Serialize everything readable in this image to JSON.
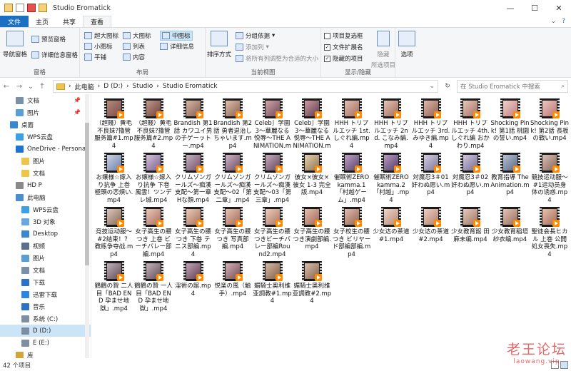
{
  "window": {
    "title": "Studio Eromatick",
    "min": "—",
    "max": "☐",
    "close": "✕"
  },
  "tabs": [
    "文件",
    "主页",
    "共享",
    "查看"
  ],
  "ribbon": {
    "panes": {
      "nav": "导航窗格",
      "preview": "预览窗格",
      "details": "详细信息窗格",
      "group": "窗格"
    },
    "layout": {
      "xl": "超大图标",
      "large": "大图标",
      "medium": "中图标",
      "small": "小图标",
      "list": "列表",
      "details": "详细信息",
      "tiles": "平铺",
      "content": "内容",
      "group": "布局"
    },
    "currentview": {
      "sort": "排序方式",
      "groupby": "分组依据",
      "addcol": "添加列",
      "fit": "将所有列调整为合适的大小",
      "group": "当前视图"
    },
    "showhide": {
      "cb_items": "项目复选框",
      "ext": "文件扩展名",
      "hidden": "隐藏的项目",
      "hide_sel1": "隐藏",
      "hide_sel2": "所选项目",
      "group": "显示/隐藏"
    },
    "options": "选项"
  },
  "address": {
    "crumbs": [
      "此电脑",
      "D (D:)",
      "Studio",
      "Studio Eromatick"
    ],
    "search_placeholder": "在 Studio Eromatick 中搜索"
  },
  "nav": [
    {
      "label": "文档",
      "icon": "document-icon",
      "color": "#7a8fa8",
      "indent": 22,
      "pin": true
    },
    {
      "label": "图片",
      "icon": "pictures-icon",
      "color": "#5a9fd4",
      "indent": 22,
      "pin": true
    },
    {
      "label": "桌面",
      "icon": "desktop-icon",
      "color": "#3a87d0",
      "indent": 14,
      "pin": false
    },
    {
      "label": "WPS云盘",
      "icon": "cloud-icon",
      "color": "#3aa0e8",
      "indent": 22,
      "pin": false
    },
    {
      "label": "OneDrive - Personal",
      "icon": "onedrive-icon",
      "color": "#1b74d0",
      "indent": 22,
      "pin": false
    },
    {
      "label": "图片",
      "icon": "folder-icon",
      "color": "#f0c34a",
      "indent": 30,
      "pin": false
    },
    {
      "label": "文档",
      "icon": "folder-icon",
      "color": "#f0c34a",
      "indent": 30,
      "pin": false
    },
    {
      "label": "HD P",
      "icon": "user-icon",
      "color": "#8a8a8a",
      "indent": 22,
      "pin": false
    },
    {
      "label": "此电脑",
      "icon": "pc-icon",
      "color": "#4c8dd0",
      "indent": 22,
      "pin": false
    },
    {
      "label": "WPS云盘",
      "icon": "cloud-icon",
      "color": "#3aa0e8",
      "indent": 30,
      "pin": false
    },
    {
      "label": "3D 对象",
      "icon": "cube-icon",
      "color": "#6aa6e0",
      "indent": 30,
      "pin": false
    },
    {
      "label": "Desktop",
      "icon": "desktop-icon",
      "color": "#3a87d0",
      "indent": 30,
      "pin": false
    },
    {
      "label": "视频",
      "icon": "video-icon",
      "color": "#5b6f8c",
      "indent": 30,
      "pin": false
    },
    {
      "label": "图片",
      "icon": "pictures-icon",
      "color": "#5a9fd4",
      "indent": 30,
      "pin": false
    },
    {
      "label": "文档",
      "icon": "document-icon",
      "color": "#7a8fa8",
      "indent": 30,
      "pin": false
    },
    {
      "label": "下载",
      "icon": "download-icon",
      "color": "#2c73c8",
      "indent": 30,
      "pin": false
    },
    {
      "label": "迅雷下载",
      "icon": "thunder-icon",
      "color": "#2b86e0",
      "indent": 30,
      "pin": false
    },
    {
      "label": "音乐",
      "icon": "music-icon",
      "color": "#2c73c8",
      "indent": 30,
      "pin": false
    },
    {
      "label": "系统 (C:)",
      "icon": "drive-icon",
      "color": "#7f8fa3",
      "indent": 30,
      "pin": false
    },
    {
      "label": "D (D:)",
      "icon": "drive-icon",
      "color": "#7f8fa3",
      "indent": 30,
      "pin": false,
      "selected": true
    },
    {
      "label": "E (E:)",
      "icon": "drive-icon",
      "color": "#7f8fa3",
      "indent": 30,
      "pin": false
    },
    {
      "label": "库",
      "icon": "library-icon",
      "color": "#d4a33a",
      "indent": 22,
      "pin": false
    }
  ],
  "files": [
    {
      "name": "（超賤）黄毛不良妹?擼管服务篇#1.mp4",
      "c1": "#b58a7a",
      "c2": "#7a4c4a"
    },
    {
      "name": "（超賤）黄毛不良妹?擼管服务篇#2.mp4",
      "c1": "#c49a8a",
      "c2": "#6d3e3c"
    },
    {
      "name": "Brandish 第1話 カワユイ男の子ゲーットー.mp4",
      "c1": "#d8b8a4",
      "c2": "#835c53"
    },
    {
      "name": "Brandish 第2話 勇者退治しちゃいます.mp4",
      "c1": "#e0c0ac",
      "c2": "#8a6252"
    },
    {
      "name": "Celeb］学園3～華麗なる悦辱～THE ANIMATION.mp4",
      "c1": "#d3a5a8",
      "c2": "#6e4a5a"
    },
    {
      "name": "Celeb］学園3～華麗なる悦辱～THE ANIMATION.mp4",
      "c1": "#cf9aa2",
      "c2": "#5a3c4e"
    },
    {
      "name": "HHH トリプルエッチ 1st. しぐれ編.mp4",
      "c1": "#e3bfb1",
      "c2": "#a06c60"
    },
    {
      "name": "HHH トリプルエッチ 2nd. こなみ編.mp4",
      "c1": "#e6c6b6",
      "c2": "#9e6a5d"
    },
    {
      "name": "HHH トリプルエッチ 3rd. みゆき編.mp4",
      "c1": "#dfb8a9",
      "c2": "#8f5f53"
    },
    {
      "name": "HHH トリプルエッチ 4th. しぐれ編 おかわり.mp4",
      "c1": "#e8c9ba",
      "c2": "#a46e61"
    },
    {
      "name": "Shocking Pink! 第1話 桃園の誓い.mp4",
      "c1": "#f2d0cc",
      "c2": "#c07e80"
    },
    {
      "name": "Shocking Pink! 第2話 長板の戦い.mp4",
      "c1": "#efc9c2",
      "c2": "#b77273"
    },
    {
      "name": "お嬢様☆嫁入り抗争 上巻 極頭の恋煩い.mp4",
      "c1": "#ccd6e8",
      "c2": "#6c7ea6"
    },
    {
      "name": "お嬢様☆嫁入り抗争 下巻 風雲！ツンデレ城.mp4",
      "c1": "#d6c4dc",
      "c2": "#7a5f8c"
    },
    {
      "name": "クリムゾンガールズ～痴漢支配～第一章 Hな顔.mp4",
      "c1": "#c9b2c2",
      "c2": "#6e4d68"
    },
    {
      "name": "クリムゾンガールズ～痴漢支配～02「第二章」.mp4",
      "c1": "#d1b7c6",
      "c2": "#6b4b62"
    },
    {
      "name": "クリムゾンガールズ～痴漢支配～03「第三章」.mp4",
      "c1": "#c8aebe",
      "c2": "#634459"
    },
    {
      "name": "彼女×彼女×彼女 1-3 完全版.mp4",
      "c1": "#e6d2b0",
      "c2": "#8e7350"
    },
    {
      "name": "催眠術ZERO kamma.1「村越ゲーム」.mp4",
      "c1": "#bda3c4",
      "c2": "#58406b"
    },
    {
      "name": "催眠術ZERO kamma.2「村越」.mp4",
      "c1": "#b89cc0",
      "c2": "#533c66"
    },
    {
      "name": "対魔忍3＃01奸わぬ愿い.mp4",
      "c1": "#d6d0e2",
      "c2": "#7b7596"
    },
    {
      "name": "対魔忍3＃02奸わぬ愿い.mp4",
      "c1": "#d2c9df",
      "c2": "#756c91"
    },
    {
      "name": "教育指導 The Animation.mp4",
      "c1": "#b9c3d6",
      "c2": "#566683"
    },
    {
      "name": "競技运动服～#1运动员身体の诱惑.mp4",
      "c1": "#dbc3b6",
      "c2": "#846457"
    },
    {
      "name": "竞技运动服～#2结束！？教练争夺战.mp4",
      "c1": "#dcc6b9",
      "c2": "#876a5c"
    },
    {
      "name": "女子高生の腰つき 上巻 ビーチバレー部編.mp4",
      "c1": "#eec6b9",
      "c2": "#a77060"
    },
    {
      "name": "女子高生の腰つき 下巻 テニス部編.mp4",
      "c1": "#eccab8",
      "c2": "#a5705d"
    },
    {
      "name": "女子高生の腰つき 写真部編.mp4",
      "c1": "#e9c2b4",
      "c2": "#a16b5b"
    },
    {
      "name": "女子高生の腰つきビーチバレー部編Round2.mp4",
      "c1": "#efcdbd",
      "c2": "#ab7664"
    },
    {
      "name": "女子高生の腰つき演劇部編.mp4",
      "c1": "#e6bfae",
      "c2": "#9c6656"
    },
    {
      "name": "女子校生の腰つき ビリヤード部編部編.mp4",
      "c1": "#e1bdae",
      "c2": "#956453"
    },
    {
      "name": "少女达の茶道#1.mp4",
      "c1": "#f0d6c9",
      "c2": "#b78774"
    },
    {
      "name": "少女达の茶道#2.mp4",
      "c1": "#eed0c2",
      "c2": "#b27f6c"
    },
    {
      "name": "少女教育館 田麻未编.mp4",
      "c1": "#e7cbbd",
      "c2": "#9f7463"
    },
    {
      "name": "少女教育稲垣紗衣编.mp4",
      "c1": "#e2c4b6",
      "c2": "#986c5b"
    },
    {
      "name": "聖徒会長ヒカル 上巻 公開処女喪失.mp4",
      "c1": "#e9c3b0",
      "c2": "#a36a55"
    },
    {
      "name": "鶴鶴の贄 二人目「BAD END 孕ませ地獄」.mp4",
      "c1": "#c2b3ba",
      "c2": "#5e4a54"
    },
    {
      "name": "鶴鶴の贄 一人目「BAD END 孕ませ地獄」.mp4",
      "c1": "#c6b5bb",
      "c2": "#614c55"
    },
    {
      "name": "淫術の館.mp4",
      "c1": "#c6a6b8",
      "c2": "#5c3c50"
    },
    {
      "name": "悦楽の風（触手）.mp4",
      "c1": "#d6b4b9",
      "c2": "#734c54"
    },
    {
      "name": "媚騎士奥利维亚調教#1.mp4",
      "c1": "#d7bba6",
      "c2": "#7f5e49"
    },
    {
      "name": "媚騎士奥利维亚調教#2.mp4",
      "c1": "#dcc0ab",
      "c2": "#84624d"
    }
  ],
  "status": {
    "count": "42 个项目"
  },
  "watermark": {
    "line1": "老王论坛",
    "line2": "laowang.vip"
  }
}
